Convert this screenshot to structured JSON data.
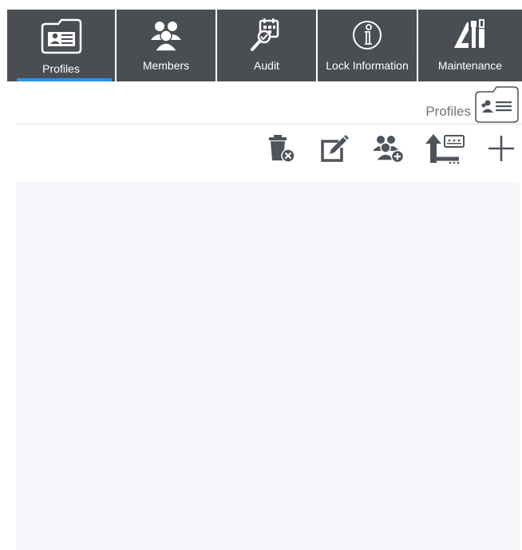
{
  "tabs": [
    {
      "id": "profiles",
      "label": "Profiles",
      "active": true
    },
    {
      "id": "members",
      "label": "Members",
      "active": false
    },
    {
      "id": "audit",
      "label": "Audit",
      "active": false
    },
    {
      "id": "lock_information",
      "label": "Lock Information",
      "active": false
    },
    {
      "id": "maintenance",
      "label": "Maintenance",
      "active": false
    }
  ],
  "section": {
    "title": "Profiles",
    "icon": "profile-card-icon"
  },
  "toolbar": {
    "actions": [
      {
        "id": "delete",
        "icon": "trash-delete-icon"
      },
      {
        "id": "edit",
        "icon": "edit-icon"
      },
      {
        "id": "add_members",
        "icon": "add-members-icon"
      },
      {
        "id": "upload",
        "icon": "upload-to-lock-icon"
      },
      {
        "id": "add",
        "icon": "plus-icon"
      }
    ]
  },
  "colors": {
    "tabbar_bg": "#4a4e53",
    "active_indicator": "#2196f3",
    "icon_gray": "#4e545b",
    "panel_bg": "#f4f6f9"
  }
}
